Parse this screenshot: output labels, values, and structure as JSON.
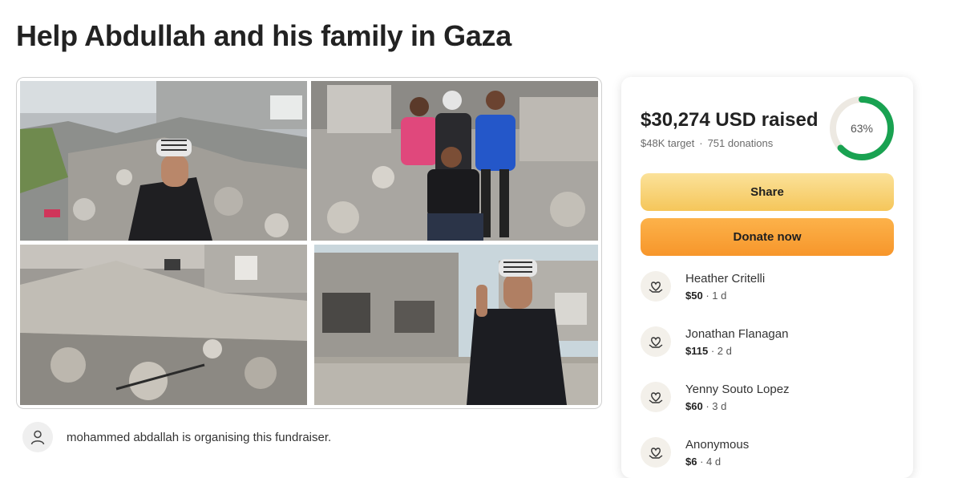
{
  "page": {
    "title": "Help Abdullah and his family in Gaza"
  },
  "gallery": {
    "photos": [
      "rubble-selfie",
      "children-on-rubble",
      "collapsed-building",
      "man-peace-sign"
    ]
  },
  "organiser": {
    "text": "mohammed abdallah is organising this fundraiser."
  },
  "progress": {
    "raised": "$30,274 USD raised",
    "target": "$48K target",
    "donations": "751 donations",
    "percent_label": "63%",
    "percent": 63,
    "ring_color": "#19a251",
    "ring_track": "#ede9e2"
  },
  "buttons": {
    "share": "Share",
    "donate": "Donate now"
  },
  "donors": [
    {
      "name": "Heather Critelli",
      "amount": "$50",
      "time": " · 1 d"
    },
    {
      "name": "Jonathan Flanagan",
      "amount": "$115",
      "time": " · 2 d"
    },
    {
      "name": "Yenny Souto Lopez",
      "amount": "$60",
      "time": " · 3 d"
    },
    {
      "name": "Anonymous",
      "amount": "$6",
      "time": " · 4 d"
    }
  ]
}
